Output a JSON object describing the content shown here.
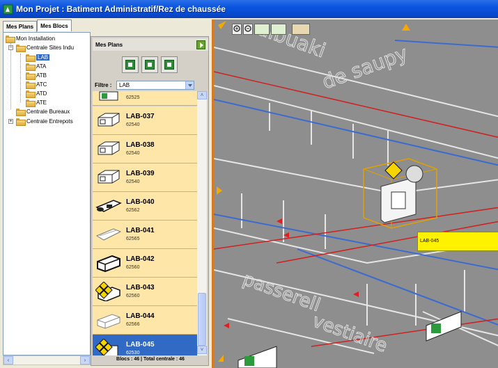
{
  "title": "Mon Projet : Batiment Administratif/Rez de chaussée",
  "tabs": [
    "Mes Plans",
    "Mes Blocs"
  ],
  "tree": {
    "root": "Mon Installation",
    "group1": "Centrale Sites Indu",
    "children": [
      "LAB",
      "ATA",
      "ATB",
      "ATC",
      "ATD",
      "ATE"
    ],
    "group2": "Centrale Bureaux",
    "group3": "Centrale Entrepots"
  },
  "plans": {
    "header": "Mes Plans",
    "filter_label": "Filtre :",
    "filter_value": "LAB",
    "items": [
      {
        "name": "",
        "code": "62525"
      },
      {
        "name": "LAB-037",
        "code": "62540"
      },
      {
        "name": "LAB-038",
        "code": "62540"
      },
      {
        "name": "LAB-039",
        "code": "62540"
      },
      {
        "name": "LAB-040",
        "code": "62562"
      },
      {
        "name": "LAB-041",
        "code": "62565"
      },
      {
        "name": "LAB-042",
        "code": "62560"
      },
      {
        "name": "LAB-043",
        "code": "62560"
      },
      {
        "name": "LAB-044",
        "code": "62566"
      },
      {
        "name": "LAB-045",
        "code": "62530"
      }
    ],
    "footer": "Blocs : 46 | Total centrale : 46"
  },
  "view": {
    "callout": "LAB-045",
    "floor_words": [
      "ulbuaki",
      "de saupy",
      "passerell",
      "vestiaire"
    ]
  },
  "colors": {
    "selection": "#316AC5",
    "item_bg": "#FDE6A8",
    "callout": "#FFF200"
  }
}
